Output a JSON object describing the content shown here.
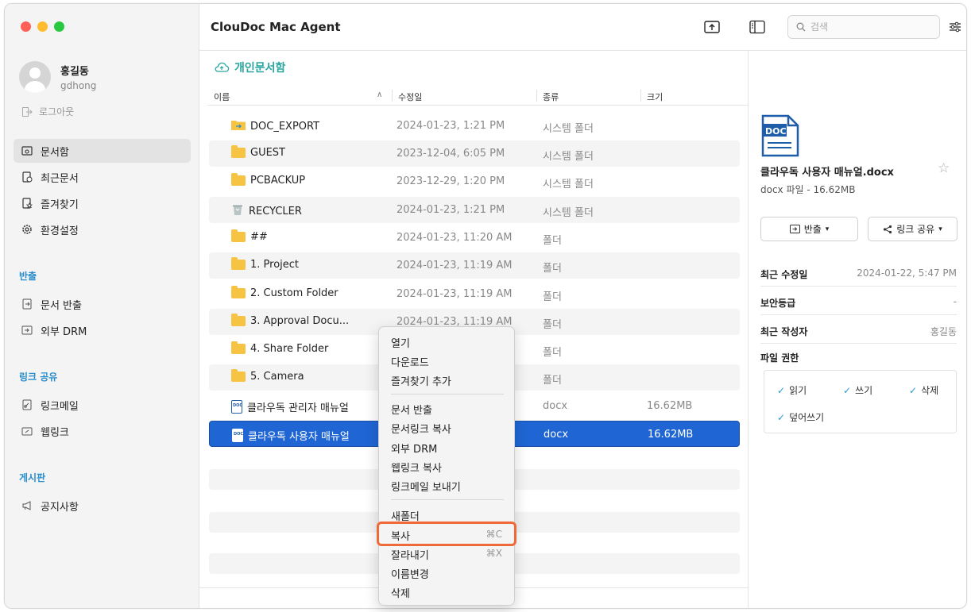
{
  "app": {
    "title": "ClouDoc Mac Agent"
  },
  "user": {
    "name": "홍길동",
    "id": "gdhong",
    "logout": "로그아웃"
  },
  "sidebar": {
    "main_items": [
      {
        "label": "문서함",
        "icon": "inbox-icon"
      },
      {
        "label": "최근문서",
        "icon": "recent-doc-icon"
      },
      {
        "label": "즐겨찾기",
        "icon": "favorite-doc-icon"
      },
      {
        "label": "환경설정",
        "icon": "gear-icon"
      }
    ],
    "sections": [
      {
        "title": "반출",
        "items": [
          {
            "label": "문서 반출",
            "icon": "export-doc-icon"
          },
          {
            "label": "외부 DRM",
            "icon": "external-drm-icon"
          }
        ]
      },
      {
        "title": "링크 공유",
        "items": [
          {
            "label": "링크메일",
            "icon": "link-mail-icon"
          },
          {
            "label": "웹링크",
            "icon": "web-link-icon"
          }
        ]
      },
      {
        "title": "게시판",
        "items": [
          {
            "label": "공지사항",
            "icon": "megaphone-icon"
          }
        ]
      }
    ]
  },
  "toolbar": {
    "search_placeholder": "검색"
  },
  "breadcrumb": {
    "label": "개인문서함"
  },
  "columns": {
    "name": "이름",
    "date": "수정일",
    "type": "종류",
    "size": "크기"
  },
  "files": [
    {
      "name": "DOC_EXPORT",
      "date": "2024-01-23, 1:21 PM",
      "type": "시스템 폴더",
      "size": "",
      "icon": "export-folder-icon"
    },
    {
      "name": "GUEST",
      "date": "2023-12-04, 6:05 PM",
      "type": "시스템 폴더",
      "size": "",
      "icon": "folder-icon"
    },
    {
      "name": "PCBACKUP",
      "date": "2023-12-29, 1:20 PM",
      "type": "시스템 폴더",
      "size": "",
      "icon": "folder-icon"
    },
    {
      "name": "RECYCLER",
      "date": "2024-01-23, 1:21 PM",
      "type": "시스템 폴더",
      "size": "",
      "icon": "trash-icon"
    },
    {
      "name": "##",
      "date": "2024-01-23, 11:20 AM",
      "type": "폴더",
      "size": "",
      "icon": "folder-icon"
    },
    {
      "name": "1. Project",
      "date": "2024-01-23, 11:19 AM",
      "type": "폴더",
      "size": "",
      "icon": "folder-icon"
    },
    {
      "name": "2. Custom Folder",
      "date": "2024-01-23, 11:19 AM",
      "type": "폴더",
      "size": "",
      "icon": "folder-icon"
    },
    {
      "name": "3. Approval Docu...",
      "date": "2024-01-23, 11:19 AM",
      "type": "폴더",
      "size": "",
      "icon": "folder-icon"
    },
    {
      "name": "4. Share Folder",
      "date": "",
      "type": "폴더",
      "size": "",
      "icon": "folder-icon"
    },
    {
      "name": "5. Camera",
      "date": "",
      "type": "폴더",
      "size": "",
      "icon": "folder-icon"
    },
    {
      "name": "클라우독 관리자 매뉴얼",
      "date": "",
      "type": "docx",
      "size": "16.62MB",
      "icon": "docx-icon"
    },
    {
      "name": "클라우독 사용자 매뉴얼",
      "date": "",
      "type": "docx",
      "size": "16.62MB",
      "icon": "docx-icon"
    }
  ],
  "context_menu": {
    "group1": [
      "열기",
      "다운로드",
      "즐겨찾기 추가"
    ],
    "group2": [
      "문서 반출",
      "문서링크 복사",
      "외부 DRM",
      "웹링크 복사",
      "링크메일 보내기"
    ],
    "group3": [
      {
        "label": "새폴더",
        "shortcut": ""
      },
      {
        "label": "복사",
        "shortcut": "⌘C"
      },
      {
        "label": "잘라내기",
        "shortcut": "⌘X"
      },
      {
        "label": "이름변경",
        "shortcut": ""
      },
      {
        "label": "삭제",
        "shortcut": ""
      }
    ]
  },
  "panel": {
    "file_name": "클라우독 사용자 매뉴얼.docx",
    "file_info": "docx 파일 - 16.62MB",
    "export_button": "반출",
    "share_button": "링크 공유",
    "props": [
      {
        "key": "최근 수정일",
        "value": "2024-01-22, 5:47 PM"
      },
      {
        "key": "보안등급",
        "value": "-"
      },
      {
        "key": "최근 작성자",
        "value": "홍길동"
      }
    ],
    "permission_title": "파일 권한",
    "permissions": [
      "읽기",
      "쓰기",
      "삭제",
      "덮어쓰기"
    ]
  },
  "colors": {
    "accent": "#2a8ecb",
    "selection": "#1f66d4",
    "highlight": "#ee6a3a",
    "folder": "#f6c343"
  }
}
